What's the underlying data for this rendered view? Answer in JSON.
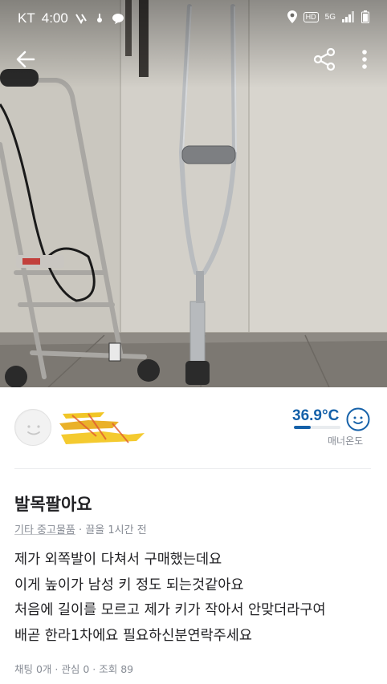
{
  "status_bar": {
    "carrier": "KT",
    "time": "4:00",
    "network": "5G"
  },
  "appbar": {
    "back_icon": "arrow-left-icon",
    "share_icon": "share-icon",
    "more_icon": "more-vertical-icon"
  },
  "seller": {
    "avatar_icon": "default-avatar-icon",
    "name_redacted": true,
    "manner_temperature": "36.9°C",
    "manner_level": 0.37,
    "manner_label": "매너온도",
    "temperature_color": "#1561a9"
  },
  "post": {
    "title": "발목팔아요",
    "category": "기타 중고물품",
    "bumped": "끌올 1시간 전",
    "description": [
      "제가 외쪽발이 다쳐서 구매했는데요",
      "이게 높이가 남성 키 정도 되는것같아요",
      "처음에 길이를 모르고 제가 키가 작아서 안맞더라구여",
      "배곧 한라1차에요  필요하신분연락주세요"
    ],
    "stats": {
      "chats": "채팅 0개",
      "likes": "관심 0",
      "views": "조회 89"
    }
  }
}
